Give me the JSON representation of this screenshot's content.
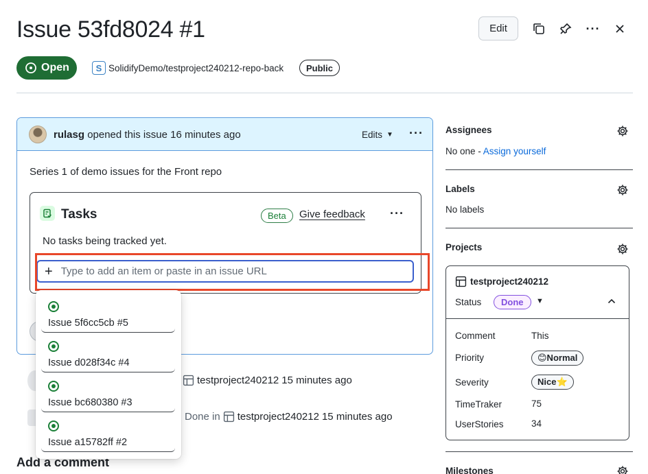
{
  "header": {
    "title": "Issue 53fd8024 #1",
    "edit_label": "Edit",
    "state": "Open",
    "repo": "SolidifyDemo/testproject240212-repo-back",
    "repo_logo": "S",
    "visibility": "Public"
  },
  "comment": {
    "author": "rulasg",
    "action": "opened this issue 16 minutes ago",
    "edits_label": "Edits",
    "body": "Series 1 of demo issues for the Front repo",
    "tasks": {
      "title": "Tasks",
      "beta": "Beta",
      "feedback": "Give feedback",
      "empty": "No tasks being tracked yet.",
      "input_placeholder": "Type to add an item or paste in an issue URL"
    }
  },
  "dropdown": {
    "items": [
      {
        "label": "Issue 5f6cc5cb #5"
      },
      {
        "label": "Issue d028f34c #4"
      },
      {
        "label": "Issue bc680380 #3"
      },
      {
        "label": "Issue a15782ff #2"
      }
    ]
  },
  "timeline": {
    "event1_project": "testproject240212",
    "event1_time": "15 minutes ago",
    "event2_prefix": "Done in",
    "event2_project": "testproject240212",
    "event2_time": "15 minutes ago",
    "add_comment": "Add a comment"
  },
  "sidebar": {
    "assignees_title": "Assignees",
    "assignees_none": "No one -",
    "assign_yourself": "Assign yourself",
    "labels_title": "Labels",
    "labels_none": "No labels",
    "projects_title": "Projects",
    "project": {
      "name": "testproject240212",
      "status_label": "Status",
      "status_value": "Done",
      "fields": [
        {
          "label": "Comment",
          "value": "This"
        },
        {
          "label": "Priority",
          "value": "😊Normal"
        },
        {
          "label": "Severity",
          "value": "Nice⭐"
        },
        {
          "label": "TimeTraker",
          "value": "75"
        },
        {
          "label": "UserStories",
          "value": "34"
        }
      ]
    },
    "milestones_title": "Milestones"
  },
  "colors": {
    "open_green": "#1f6d34",
    "highlight": "#e8472a",
    "link": "#0969da",
    "done_purple": "#8250df"
  }
}
